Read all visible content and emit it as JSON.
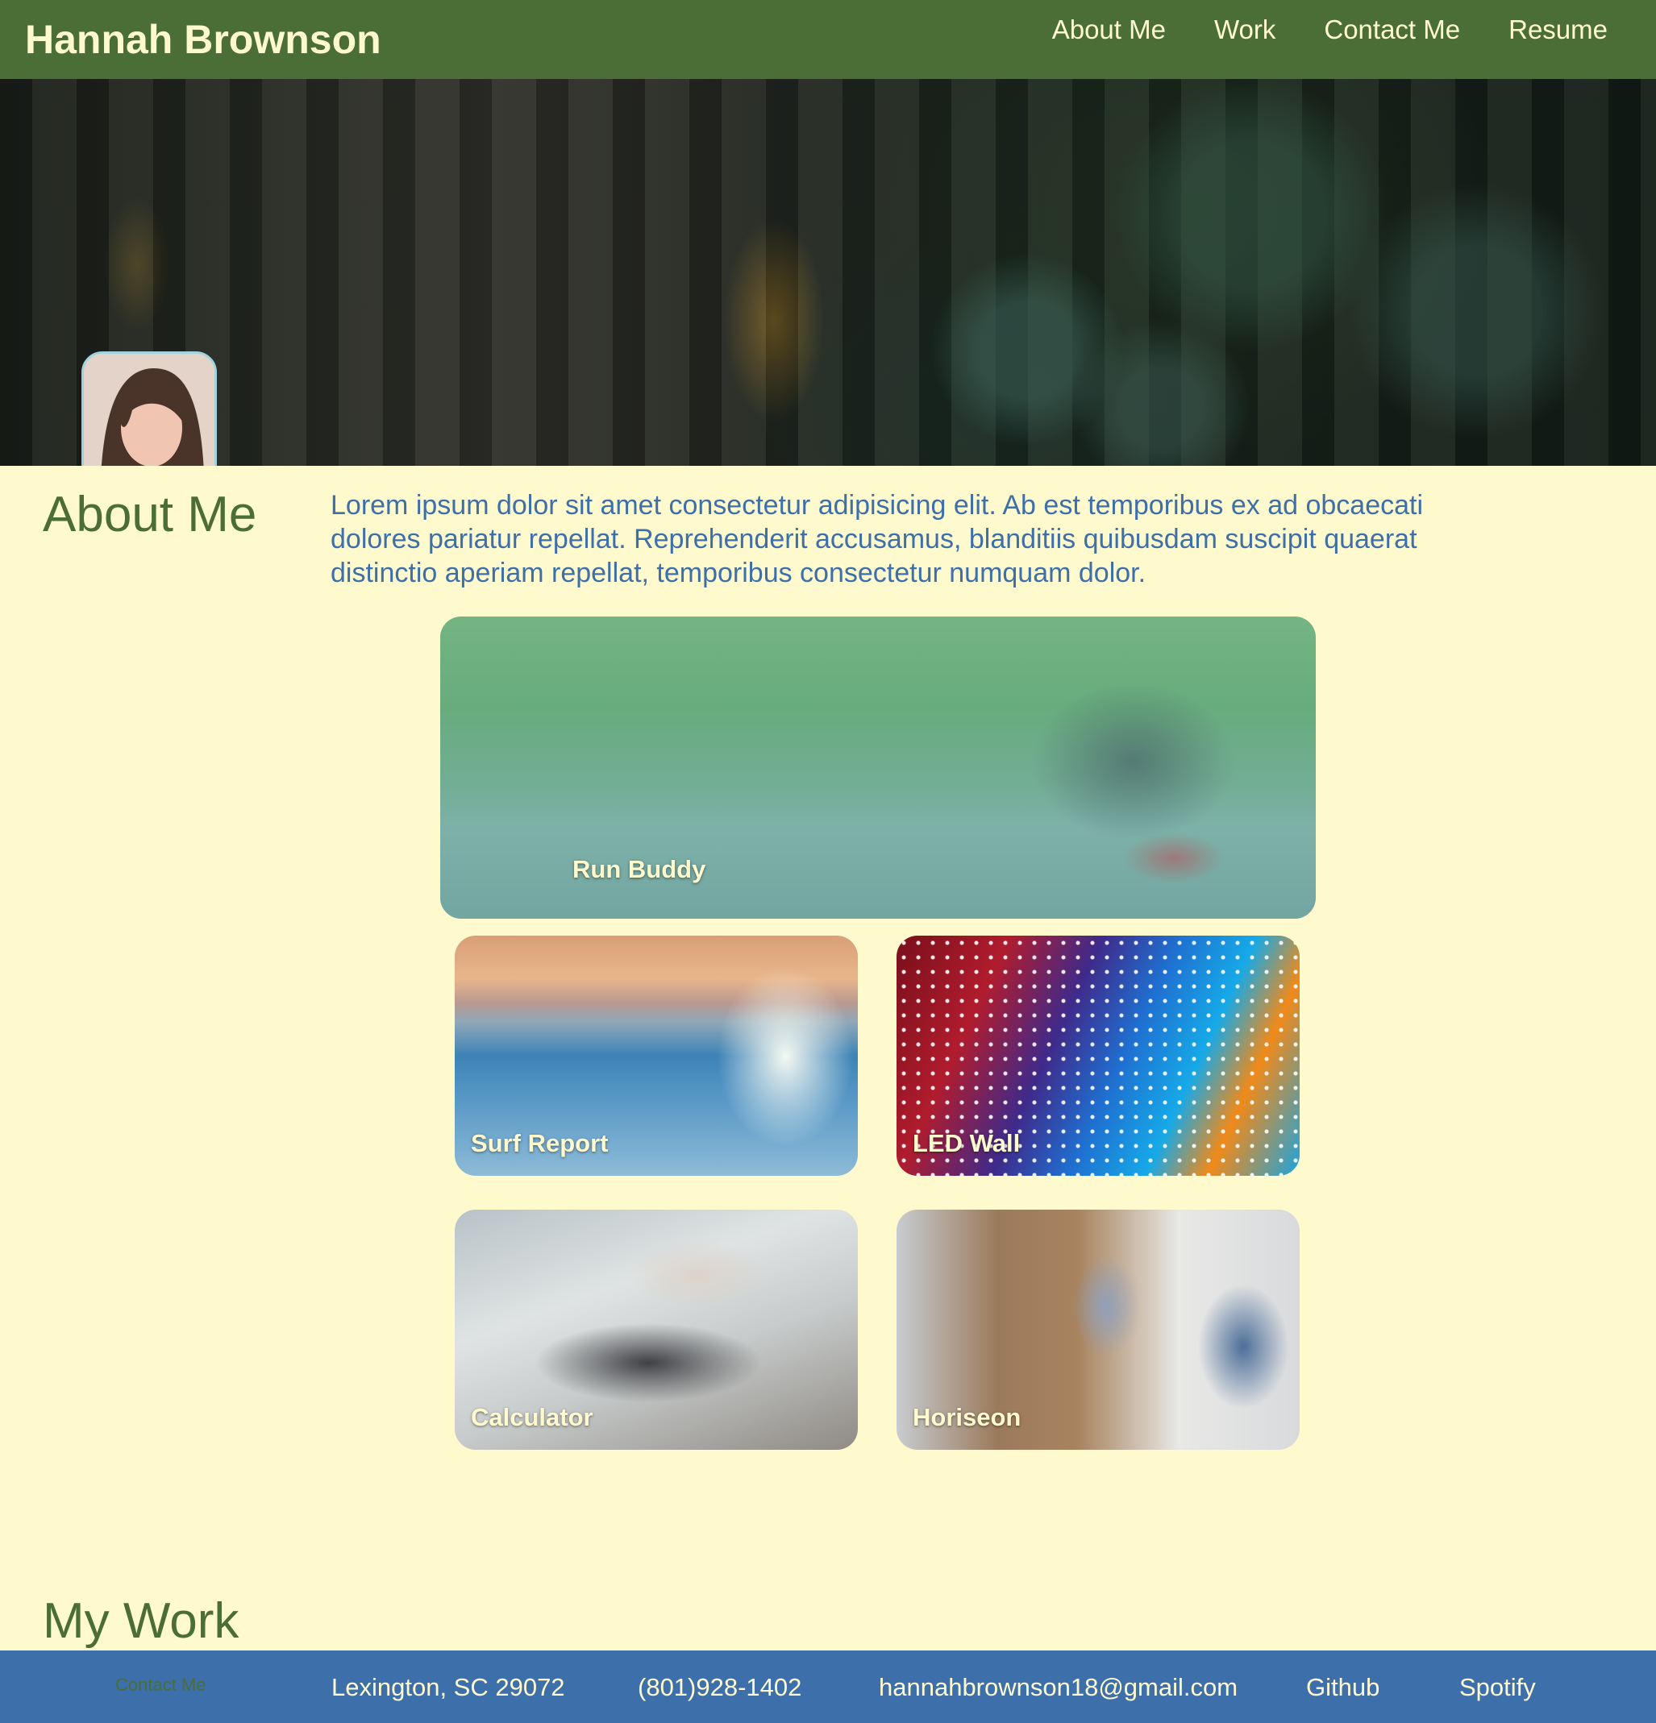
{
  "header": {
    "brand": "Hannah Brownson",
    "nav": [
      "About Me",
      "Work",
      "Contact Me",
      "Resume"
    ]
  },
  "about": {
    "heading": "About Me",
    "text": "Lorem ipsum dolor sit amet consectetur adipisicing elit. Ab est temporibus ex ad obcaecati dolores pariatur repellat. Reprehenderit accusamus, blanditiis quibusdam suscipit quaerat distinctio aperiam repellat, temporibus consectetur numquam dolor."
  },
  "work": {
    "projects": [
      "Run Buddy",
      "Surf Report",
      "LED Wall",
      "Calculator",
      "Horiseon"
    ],
    "heading": "My Work"
  },
  "footer": {
    "contact_title": "Contact Me",
    "location": "Lexington, SC 29072",
    "phone": "(801)928-1402",
    "email": "hannahbrownson18@gmail.com",
    "github": "Github",
    "spotify": "Spotify"
  },
  "colors": {
    "header_green": "#4a6e36",
    "page_background": "#fffacd",
    "text_blue": "#3d6faa",
    "footer_blue": "#3d6faa"
  }
}
